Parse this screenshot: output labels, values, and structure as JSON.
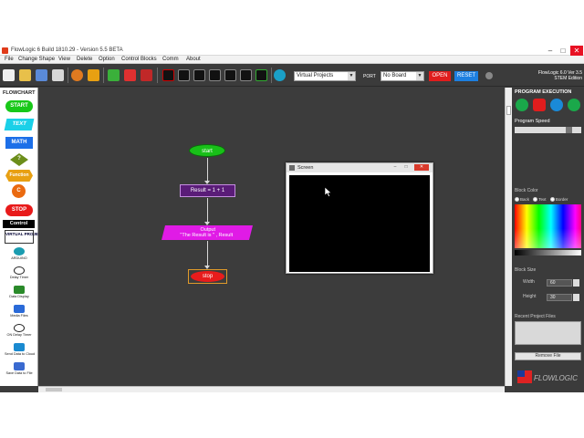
{
  "window": {
    "title": "FlowLogic 6 Build 1810.29 - Version 5.5 BETA",
    "minimize": "–",
    "maximize": "□",
    "close": "✕"
  },
  "menu": [
    "File",
    "Change Shape",
    "View",
    "Delete",
    "Option",
    "Control Blocks",
    "Comm",
    "About"
  ],
  "toolbar": {
    "project_select": "Virtual Projects",
    "port_label": "PORT",
    "port_select": "No Board",
    "open_label": "OPEN",
    "reset_label": "RESET",
    "version_line1": "FlowLogic 6.0 Ver 3.5",
    "version_line2": "STEM Edition"
  },
  "palette": {
    "title": "FLOWCHART",
    "start": "START",
    "text": "TEXT",
    "math": "MATH",
    "decision": "?",
    "function": "Function",
    "connector": "C",
    "stop": "STOP",
    "control": "Control",
    "virtual_project": "VIRTUAL PROJECT",
    "arduino": "ARDUINO",
    "delay_timer": "Delay Timer",
    "data_display": "Data Display",
    "media_files": "Media Files",
    "on_delay_timer": "ON Delay Timer",
    "send_cloud": "Send Data to Cloud",
    "save_file": "Save Data to File"
  },
  "flowchart": {
    "start": "start",
    "process": "Result = 1 + 1",
    "output_line1": "Output",
    "output_line2": "\"The Result is \" , Result",
    "stop": "stop"
  },
  "screen_window": {
    "title": "Screen"
  },
  "right_panel": {
    "program_execution": "PROGRAM EXECUTION",
    "program_speed": "Program Speed",
    "block_color": "Block Color",
    "radio_back": "Back",
    "radio_text": "Text",
    "radio_border": "Border",
    "block_size": "Block Size",
    "width_label": "Width",
    "width_value": "60",
    "height_label": "Height",
    "height_value": "30",
    "recent_files": "Recent Project Files",
    "remove_file": "Remove File",
    "logo_text": "FLOWLOGIC"
  },
  "colors": {
    "accent_open": "#e01d1d",
    "accent_reset": "#1d7fe0",
    "start_green": "#18c018",
    "stop_red": "#e81c1c",
    "output_magenta": "#e01be6",
    "process_purple": "#5a1c78"
  }
}
